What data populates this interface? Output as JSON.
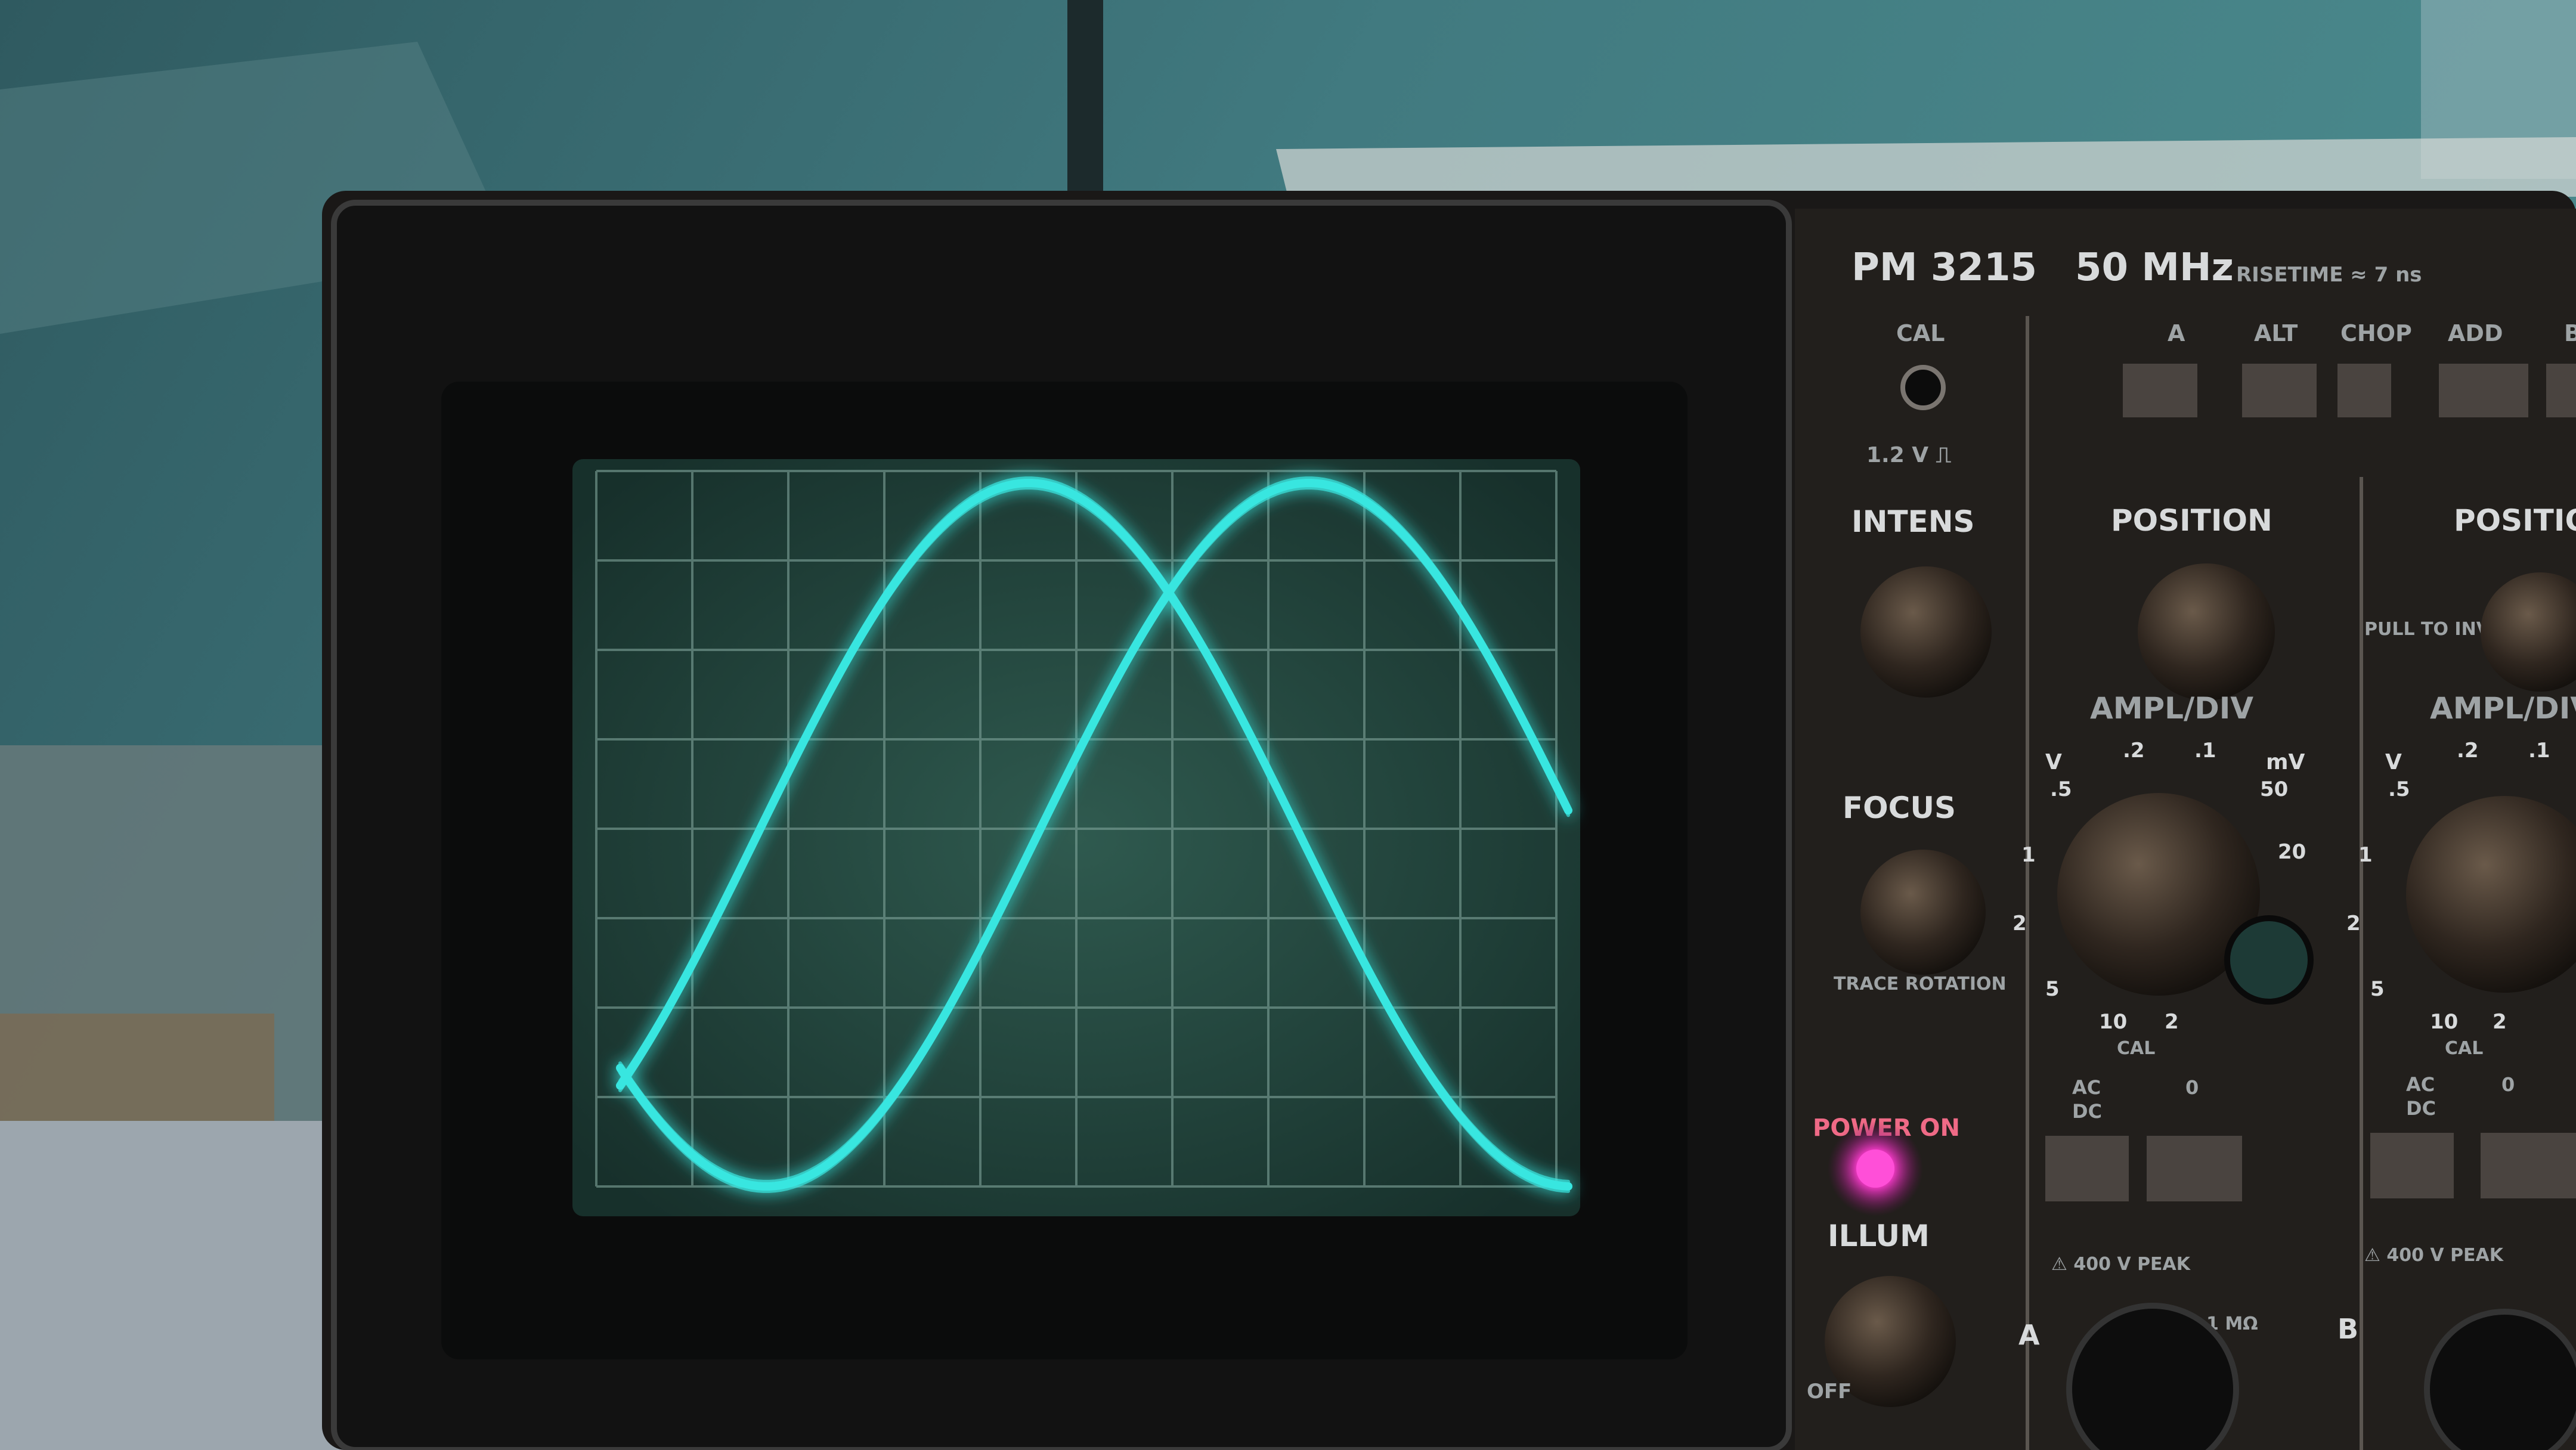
{
  "image": {
    "subject": "oscilloscope",
    "colors": {
      "trace": "#39e6e0",
      "background_wall": "#3d7076",
      "panel": "#1f1c1a",
      "bezel": "#141414",
      "screen": "#23473f",
      "power_led": "#ff3cd0"
    }
  },
  "panel": {
    "model": "PM 3215",
    "bandwidth": "50 MHz",
    "risetime": "RISETIME ≈ 7 ns",
    "cal": "CAL",
    "cal_value": "1.2 V ⎍",
    "buttons": [
      "A",
      "ALT",
      "CHOP",
      "ADD",
      "B"
    ],
    "intens": "INTENS",
    "focus": "FOCUS",
    "trace_rotation": "TRACE ROTATION",
    "power_on": "POWER ON",
    "illum": "ILLUM",
    "off": "OFF",
    "position_a": "POSITION",
    "position_b": "POSITIO",
    "pull_to_invert": "PULL TO INVERT",
    "ampl_div": "AMPL/DIV",
    "v": "V",
    "mv": "mV",
    "scale_a": [
      ".5",
      ".2",
      ".1",
      "50",
      "20",
      "1",
      "2",
      "5",
      "10",
      "2"
    ],
    "scale_b": [
      ".5",
      ".2",
      ".1",
      "1",
      "2",
      "5",
      "10",
      "2"
    ],
    "cal_small": "CAL",
    "ac": "AC",
    "dc": "DC",
    "zero": "0",
    "peak": "⚠ 400 V PEAK",
    "input_a": "A",
    "input_b": "B",
    "mohm": "1 MΩ"
  }
}
